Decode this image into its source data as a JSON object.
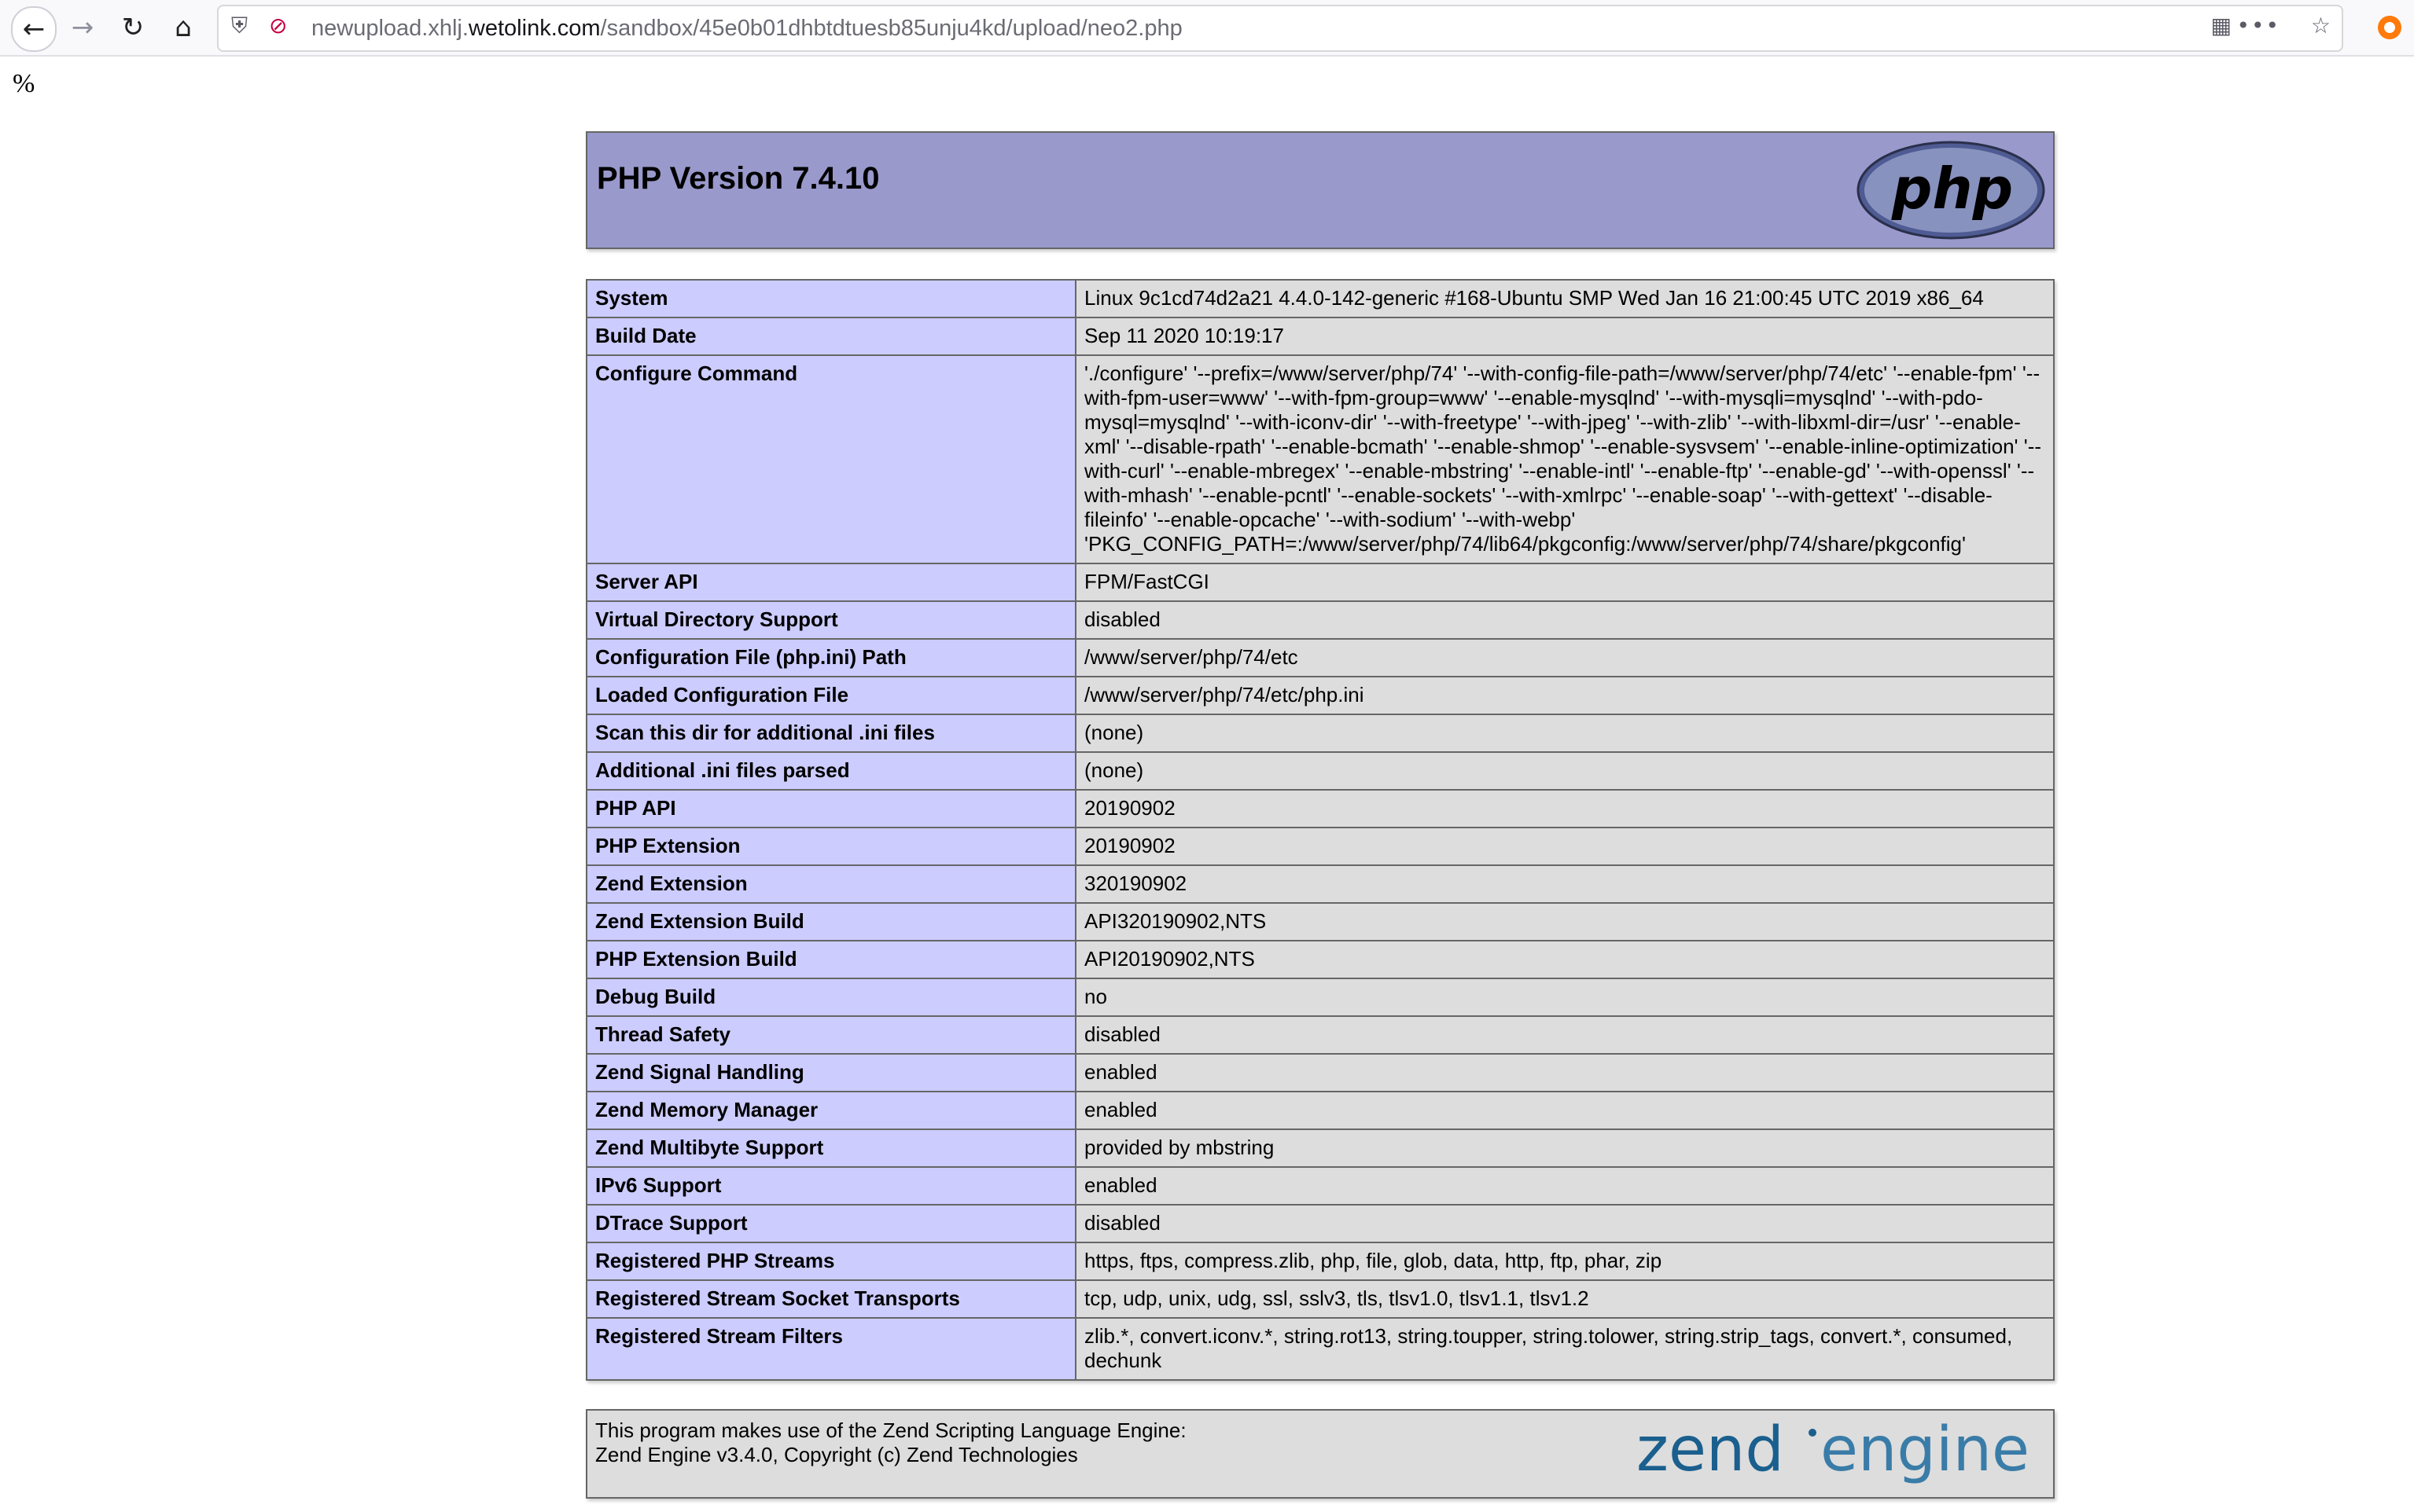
{
  "browser": {
    "url_prefix": "newupload.xhlj.",
    "url_domain": "wetolink.com",
    "url_path": "/sandbox/45e0b01dhbtdtuesb85unju4kd/upload/neo2.php"
  },
  "page": {
    "stray_text": "%",
    "title": "PHP Version 7.4.10",
    "logo_text": "php",
    "rows": [
      {
        "key": "System",
        "value": "Linux 9c1cd74d2a21 4.4.0-142-generic #168-Ubuntu SMP Wed Jan 16 21:00:45 UTC 2019 x86_64"
      },
      {
        "key": "Build Date",
        "value": "Sep 11 2020 10:19:17"
      },
      {
        "key": "Configure Command",
        "value": "'./configure' '--prefix=/www/server/php/74' '--with-config-file-path=/www/server/php/74/etc' '--enable-fpm' '--with-fpm-user=www' '--with-fpm-group=www' '--enable-mysqlnd' '--with-mysqli=mysqlnd' '--with-pdo-mysql=mysqlnd' '--with-iconv-dir' '--with-freetype' '--with-jpeg' '--with-zlib' '--with-libxml-dir=/usr' '--enable-xml' '--disable-rpath' '--enable-bcmath' '--enable-shmop' '--enable-sysvsem' '--enable-inline-optimization' '--with-curl' '--enable-mbregex' '--enable-mbstring' '--enable-intl' '--enable-ftp' '--enable-gd' '--with-openssl' '--with-mhash' '--enable-pcntl' '--enable-sockets' '--with-xmlrpc' '--enable-soap' '--with-gettext' '--disable-fileinfo' '--enable-opcache' '--with-sodium' '--with-webp' 'PKG_CONFIG_PATH=:/www/server/php/74/lib64/pkgconfig:/www/server/php/74/share/pkgconfig'"
      },
      {
        "key": "Server API",
        "value": "FPM/FastCGI"
      },
      {
        "key": "Virtual Directory Support",
        "value": "disabled"
      },
      {
        "key": "Configuration File (php.ini) Path",
        "value": "/www/server/php/74/etc"
      },
      {
        "key": "Loaded Configuration File",
        "value": "/www/server/php/74/etc/php.ini"
      },
      {
        "key": "Scan this dir for additional .ini files",
        "value": "(none)"
      },
      {
        "key": "Additional .ini files parsed",
        "value": "(none)"
      },
      {
        "key": "PHP API",
        "value": "20190902"
      },
      {
        "key": "PHP Extension",
        "value": "20190902"
      },
      {
        "key": "Zend Extension",
        "value": "320190902"
      },
      {
        "key": "Zend Extension Build",
        "value": "API320190902,NTS"
      },
      {
        "key": "PHP Extension Build",
        "value": "API20190902,NTS"
      },
      {
        "key": "Debug Build",
        "value": "no"
      },
      {
        "key": "Thread Safety",
        "value": "disabled"
      },
      {
        "key": "Zend Signal Handling",
        "value": "enabled"
      },
      {
        "key": "Zend Memory Manager",
        "value": "enabled"
      },
      {
        "key": "Zend Multibyte Support",
        "value": "provided by mbstring"
      },
      {
        "key": "IPv6 Support",
        "value": "enabled"
      },
      {
        "key": "DTrace Support",
        "value": "disabled"
      },
      {
        "key": "Registered PHP Streams",
        "value": "https, ftps, compress.zlib, php, file, glob, data, http, ftp, phar, zip"
      },
      {
        "key": "Registered Stream Socket Transports",
        "value": "tcp, udp, unix, udg, ssl, sslv3, tls, tlsv1.0, tlsv1.1, tlsv1.2"
      },
      {
        "key": "Registered Stream Filters",
        "value": "zlib.*, convert.iconv.*, string.rot13, string.toupper, string.tolower, string.strip_tags, convert.*, consumed, dechunk"
      }
    ],
    "zend_line1": "This program makes use of the Zend Scripting Language Engine:",
    "zend_line2": "Zend Engine v3.4.0, Copyright (c) Zend Technologies",
    "zend_logo_word1": "zend",
    "zend_logo_word2": "engine"
  },
  "icons": [
    "back-icon",
    "forward-icon",
    "reload-icon",
    "home-icon",
    "shield-icon",
    "insecure-lock-icon",
    "qr-code-icon",
    "more-icon",
    "bookmark-star-icon",
    "extension-icon"
  ],
  "colors": {
    "header": "#9999cc",
    "key_cell": "#ccccff",
    "value_cell": "#dddddd",
    "border": "#666666"
  }
}
